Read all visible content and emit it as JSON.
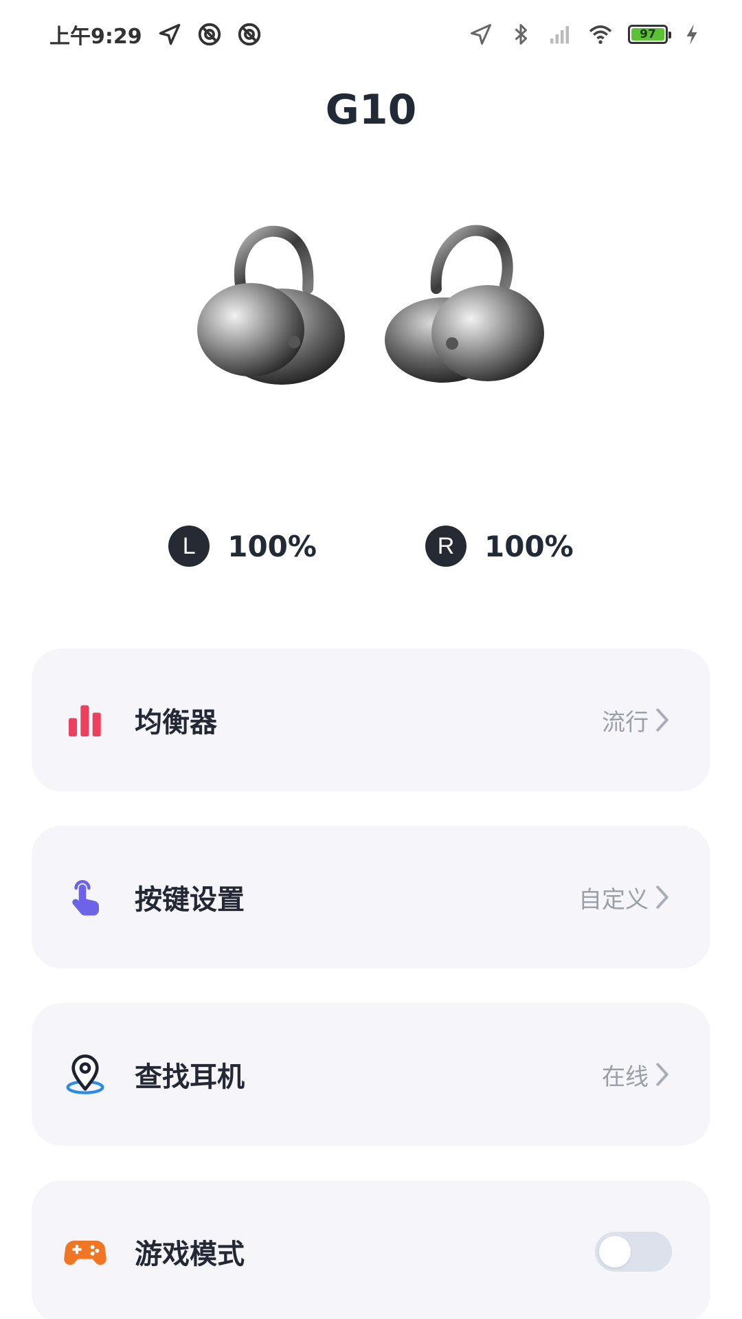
{
  "status_bar": {
    "time": "上午9:29",
    "battery_level": "97"
  },
  "device": {
    "title": "G10"
  },
  "battery": {
    "left_label": "L",
    "left_value": "100%",
    "right_label": "R",
    "right_value": "100%"
  },
  "menu": [
    {
      "label": "均衡器",
      "value": "流行",
      "icon": "equalizer-icon",
      "color": "#ee3f5f"
    },
    {
      "label": "按键设置",
      "value": "自定义",
      "icon": "touch-icon",
      "color": "#6c63e8"
    },
    {
      "label": "查找耳机",
      "value": "在线",
      "icon": "location-pin-icon",
      "color": "#1f2330"
    },
    {
      "label": "游戏模式",
      "toggle_on": false,
      "icon": "gamepad-icon",
      "color": "#f07624"
    }
  ],
  "colors": {
    "card_bg": "#f5f5fa",
    "toggle_off": "#dde1ec",
    "value_gray": "#9aa0a8"
  }
}
